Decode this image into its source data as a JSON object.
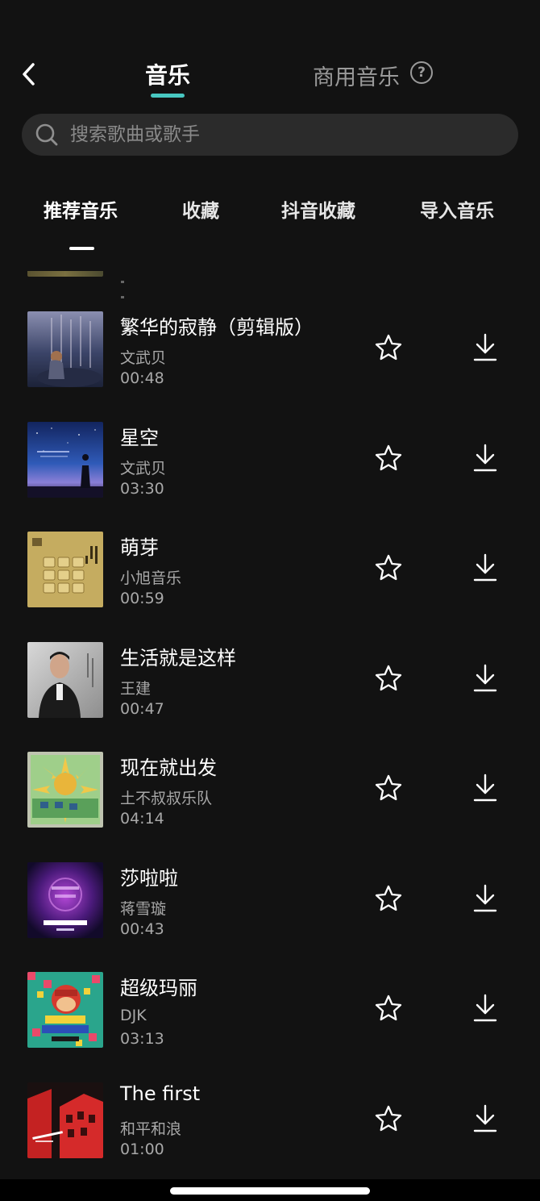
{
  "header": {
    "tab_music": "音乐",
    "tab_commercial": "商用音乐",
    "help_symbol": "?",
    "accent_color": "#48c7c1"
  },
  "search": {
    "placeholder": "搜索歌曲或歌手"
  },
  "category_tabs": [
    {
      "label": "推荐音乐",
      "active": true
    },
    {
      "label": "收藏",
      "active": false
    },
    {
      "label": "抖音收藏",
      "active": false
    },
    {
      "label": "导入音乐",
      "active": false
    }
  ],
  "songs": [
    {
      "title": "繁华的寂静（剪辑版）",
      "artist": "文武贝",
      "duration": "00:48",
      "cover": "night-forest-girl",
      "favorited": false
    },
    {
      "title": "星空",
      "artist": "文武贝",
      "duration": "03:30",
      "cover": "starry-sky-silhouette",
      "favorited": false
    },
    {
      "title": "萌芽",
      "artist": "小旭音乐",
      "duration": "00:59",
      "cover": "yellow-squares-grid",
      "favorited": false
    },
    {
      "title": "生活就是这样",
      "artist": "王建",
      "duration": "00:47",
      "cover": "man-portrait",
      "favorited": false
    },
    {
      "title": "现在就出发",
      "artist": "土不叔叔乐队",
      "duration": "04:14",
      "cover": "sun-illustration",
      "favorited": false
    },
    {
      "title": "莎啦啦",
      "artist": "蒋雪璇",
      "duration": "00:43",
      "cover": "purple-glow",
      "favorited": false
    },
    {
      "title": "超级玛丽",
      "artist": "DJK",
      "duration": "03:13",
      "cover": "mario-pixel-art",
      "favorited": false
    },
    {
      "title": "The first",
      "artist": "和平和浪",
      "duration": "01:00",
      "cover": "red-building",
      "favorited": false
    }
  ],
  "icons": {
    "back": "chevron-left-icon",
    "search": "search-icon",
    "help": "help-circle-icon",
    "favorite": "star-outline-icon",
    "download": "download-icon"
  }
}
